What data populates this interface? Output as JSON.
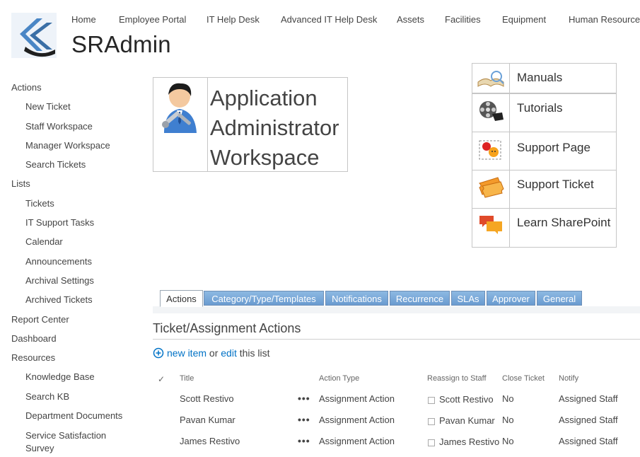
{
  "top_nav": {
    "items": [
      "Home",
      "Employee Portal",
      "IT Help Desk",
      "Advanced IT Help Desk",
      "Assets",
      "Facilities",
      "Equipment",
      "Human Resources"
    ]
  },
  "site": {
    "title": "SRAdmin"
  },
  "left_nav": {
    "groups": [
      {
        "label": "Actions",
        "items": [
          "New Ticket",
          "Staff Workspace",
          "Manager Workspace",
          "Search Tickets"
        ]
      },
      {
        "label": "Lists",
        "items": [
          "Tickets",
          "IT Support Tasks",
          "Calendar",
          "Announcements",
          "Archival Settings",
          "Archived Tickets"
        ]
      },
      {
        "label": "Report Center",
        "items": []
      },
      {
        "label": "Dashboard",
        "items": []
      },
      {
        "label": "Resources",
        "items": [
          "Knowledge Base",
          "Search KB",
          "Department Documents",
          "Service Satisfaction Survey"
        ]
      }
    ]
  },
  "workspace": {
    "title_lines": [
      "Application",
      "Administrator",
      "Workspace"
    ]
  },
  "link_panel": {
    "items": [
      {
        "label": "Manuals",
        "icon": "book-icon"
      },
      {
        "label": "Tutorials",
        "icon": "film-reel-icon"
      },
      {
        "label": "Support Page",
        "icon": "support-page-icon"
      },
      {
        "label": "Support Ticket",
        "icon": "ticket-icon"
      },
      {
        "label": "Learn SharePoint",
        "icon": "chat-bubbles-icon"
      }
    ]
  },
  "tabs": [
    "Actions",
    "Category/Type/Templates",
    "Notifications",
    "Recurrence",
    "SLAs",
    "Approver",
    "General"
  ],
  "active_tab": "Actions",
  "section": {
    "title": "Ticket/Assignment Actions"
  },
  "list_actions": {
    "new_item": "new item",
    "or": "or",
    "edit": "edit",
    "this_list": "this list"
  },
  "table": {
    "check_header": "✓",
    "headers": [
      "Title",
      "Action Type",
      "Reassign to Staff",
      "Close Ticket",
      "Notify"
    ],
    "rows": [
      {
        "title": "Scott Restivo",
        "action_type": "Assignment Action",
        "reassign": "Scott Restivo",
        "close": "No",
        "notify": "Assigned Staff"
      },
      {
        "title": "Pavan Kumar",
        "action_type": "Assignment Action",
        "reassign": "Pavan Kumar",
        "close": "No",
        "notify": "Assigned Staff"
      },
      {
        "title": "James Restivo",
        "action_type": "Assignment Action",
        "reassign": "James Restivo",
        "close": "No",
        "notify": "Assigned Staff"
      }
    ],
    "ellipsis": "•••"
  },
  "colors": {
    "link": "#0072c6",
    "tab_blue": "#7aa7d8",
    "border": "#c6c6c6"
  }
}
